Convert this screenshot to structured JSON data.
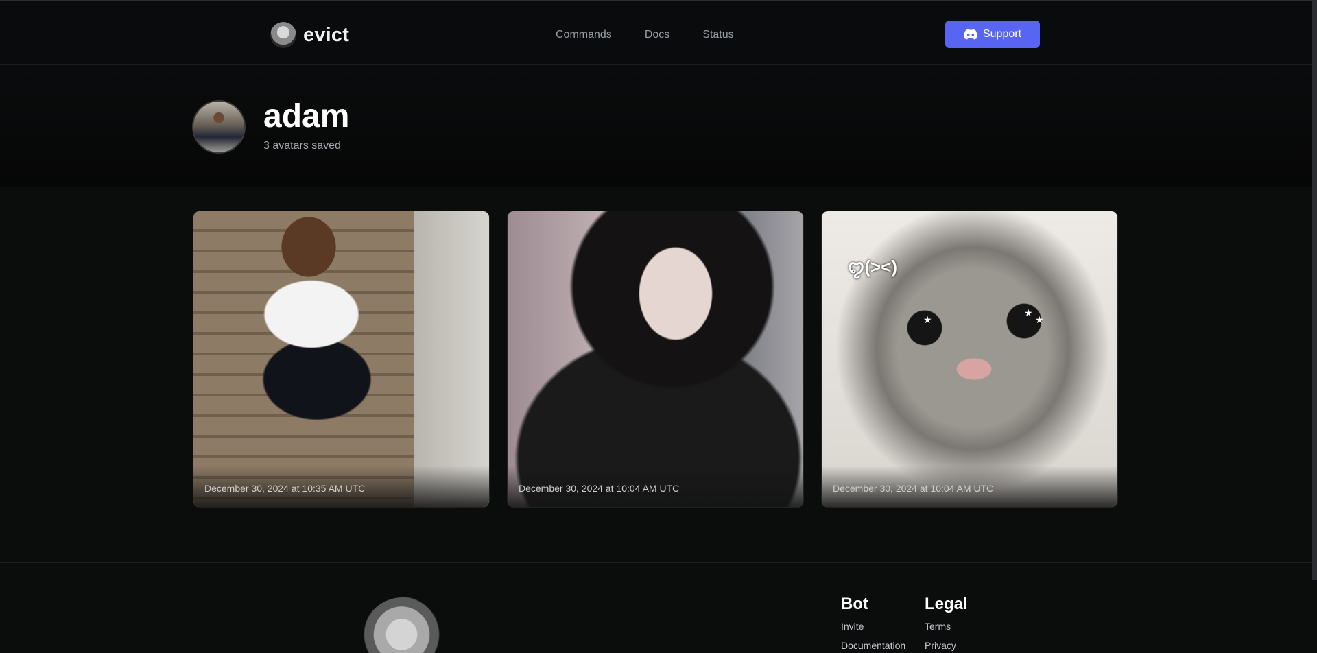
{
  "header": {
    "brand": "evict",
    "nav": [
      "Commands",
      "Docs",
      "Status"
    ],
    "support_label": "Support"
  },
  "profile": {
    "username": "adam",
    "subtitle": "3 avatars saved"
  },
  "avatars": [
    {
      "timestamp": "December 30, 2024 at 10:35 AM UTC"
    },
    {
      "timestamp": "December 30, 2024 at 10:04 AM UTC"
    },
    {
      "timestamp": "December 30, 2024 at 10:04 AM UTC"
    }
  ],
  "overlay": {
    "kaomoji": "ꨄ(><)"
  },
  "footer": {
    "bot": {
      "title": "Bot",
      "links": [
        "Invite",
        "Documentation"
      ]
    },
    "legal": {
      "title": "Legal",
      "links": [
        "Terms",
        "Privacy"
      ]
    }
  },
  "colors": {
    "accent": "#5865f2",
    "background": "#0b0c0c"
  }
}
